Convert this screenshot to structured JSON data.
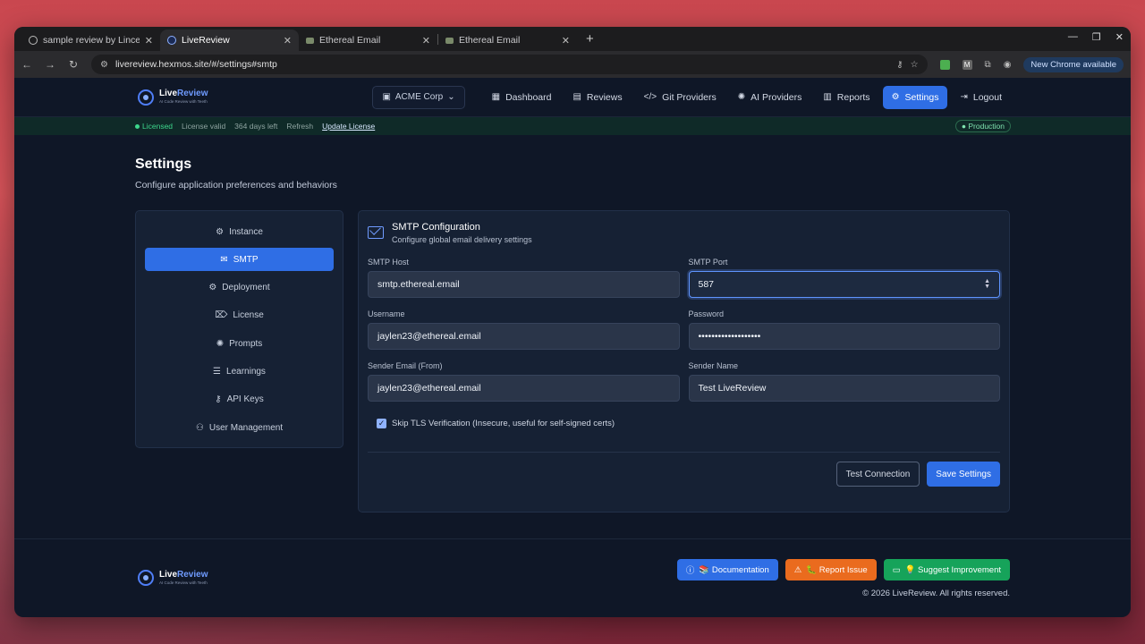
{
  "browser": {
    "tabs": [
      {
        "title": "sample review by Linced",
        "active": false
      },
      {
        "title": "LiveReview",
        "active": true
      },
      {
        "title": "Ethereal Email",
        "active": false
      },
      {
        "title": "Ethereal Email",
        "active": false
      }
    ],
    "url": "livereview.hexmos.site/#/settings#smtp",
    "update_badge": "New Chrome available"
  },
  "app": {
    "brand_a": "Live",
    "brand_b": "Review",
    "brand_sub": "AI Code Review with Teeth",
    "org": "ACME Corp",
    "nav": [
      {
        "label": "Dashboard",
        "icon": "dashboard-icon"
      },
      {
        "label": "Reviews",
        "icon": "document-icon"
      },
      {
        "label": "Git Providers",
        "icon": "code-icon"
      },
      {
        "label": "AI Providers",
        "icon": "bulb-icon"
      },
      {
        "label": "Reports",
        "icon": "chart-icon"
      },
      {
        "label": "Settings",
        "icon": "gear-icon",
        "active": true
      },
      {
        "label": "Logout",
        "icon": "logout-icon"
      }
    ]
  },
  "license": {
    "status": "Licensed",
    "valid": "License valid",
    "days": "364 days left",
    "refresh": "Refresh",
    "update": "Update License",
    "env": "Production"
  },
  "page": {
    "title": "Settings",
    "subtitle": "Configure application preferences and behaviors"
  },
  "sidebar": {
    "items": [
      {
        "label": "Instance",
        "icon": "gear-icon"
      },
      {
        "label": "SMTP",
        "icon": "mail-icon",
        "active": true
      },
      {
        "label": "Deployment",
        "icon": "gear-icon"
      },
      {
        "label": "License",
        "icon": "tag-icon"
      },
      {
        "label": "Prompts",
        "icon": "bulb-icon"
      },
      {
        "label": "Learnings",
        "icon": "list-icon"
      },
      {
        "label": "API Keys",
        "icon": "key-icon"
      },
      {
        "label": "User Management",
        "icon": "users-icon"
      }
    ]
  },
  "smtp": {
    "title": "SMTP Configuration",
    "subtitle": "Configure global email delivery settings",
    "host_label": "SMTP Host",
    "host": "smtp.ethereal.email",
    "port_label": "SMTP Port",
    "port": "587",
    "user_label": "Username",
    "user": "jaylen23@ethereal.email",
    "pass_label": "Password",
    "pass": "•••••••••••••••••••",
    "from_label": "Sender Email (From)",
    "from": "jaylen23@ethereal.email",
    "name_label": "Sender Name",
    "name": "Test LiveReview",
    "tls_label": "Skip TLS Verification (Insecure, useful for self-signed certs)",
    "tls_checked": true,
    "test_btn": "Test Connection",
    "save_btn": "Save Settings"
  },
  "footer": {
    "docs": "📚 Documentation",
    "issue": "🐛 Report Issue",
    "suggest": "💡 Suggest Improvement",
    "copyright": "© 2026 LiveReview. All rights reserved."
  },
  "colors": {
    "accent": "#2f6ee5",
    "bg": "#0f1727",
    "panel": "#162134",
    "success": "#3dd68c"
  }
}
